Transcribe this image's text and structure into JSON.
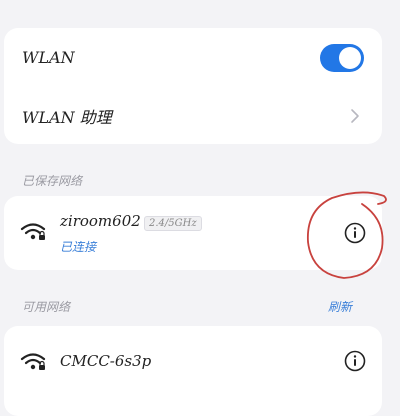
{
  "wlan": {
    "label": "WLAN",
    "enabled": true
  },
  "assistant": {
    "label": "WLAN 助理"
  },
  "saved_section": {
    "label": "已保存网络"
  },
  "saved_networks": [
    {
      "name": "ziroom602",
      "band": "2.4/5GHz",
      "status": "已连接"
    }
  ],
  "available_section": {
    "label": "可用网络",
    "refresh_label": "刷新"
  },
  "available_networks": [
    {
      "name": "CMCC-6s3p"
    }
  ],
  "colors": {
    "accent": "#2277e6",
    "link": "#3a7fd8",
    "annotation": "#c8423e"
  }
}
